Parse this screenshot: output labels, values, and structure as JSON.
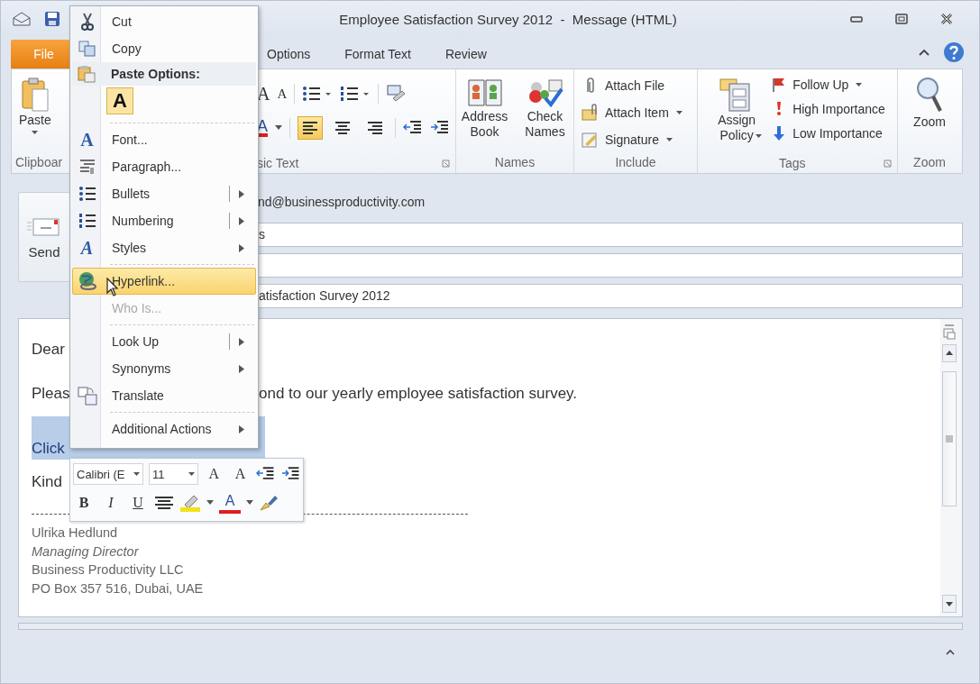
{
  "window": {
    "title": "Employee Satisfaction Survey 2012  -  Message (HTML)"
  },
  "tabs": [
    {
      "label": "File",
      "kind": "file"
    },
    {
      "label": "Options",
      "kind": "tab"
    },
    {
      "label": "Format Text",
      "kind": "tab"
    },
    {
      "label": "Review",
      "kind": "tab"
    }
  ],
  "clipboard": {
    "label": "Clipboar",
    "paste": "Paste"
  },
  "basic_text": {
    "label": "sic Text",
    "grow_font": "A",
    "shrink_font": "A",
    "font_color": "A",
    "align": [
      {
        "selected": true
      },
      {
        "selected": false
      },
      {
        "selected": false
      }
    ]
  },
  "names": {
    "label": "Names",
    "buttons": [
      "Address Book",
      "Check Names"
    ]
  },
  "include": {
    "label": "Include",
    "buttons": [
      {
        "label": "Attach File",
        "dropdown": false
      },
      {
        "label": "Attach Item",
        "dropdown": true
      },
      {
        "label": "Signature",
        "dropdown": true
      }
    ]
  },
  "tags": {
    "label": "Tags",
    "assign_policy": "Assign Policy",
    "buttons": [
      {
        "label": "Follow Up",
        "dropdown": true
      },
      {
        "label": "High Importance",
        "dropdown": false
      },
      {
        "label": "Low Importance",
        "dropdown": false
      }
    ]
  },
  "zoom": {
    "label": "Zoom",
    "button": "Zoom"
  },
  "message": {
    "send": "Send",
    "from": "nd@businessproductivity.com",
    "to": "s",
    "subject": "atisfaction Survey 2012"
  },
  "body": {
    "greeting": "Dear",
    "line_start": "Pleas",
    "line_end": "ond to our yearly employee satisfaction survey.",
    "link": "Click",
    "closing": "Kind",
    "signature": [
      {
        "text": "Ulrika Hedlund",
        "italic": false
      },
      {
        "text": "Managing Director",
        "italic": true
      },
      {
        "text": "Business Productivity LLC",
        "italic": false
      },
      {
        "text": "PO Box 357 516, Dubai, UAE",
        "italic": false
      }
    ]
  },
  "context_menu": {
    "items": [
      {
        "kind": "item",
        "label": "Cut",
        "selected": false,
        "disabled": false
      },
      {
        "kind": "item",
        "label": "Copy",
        "selected": false,
        "disabled": false
      },
      {
        "kind": "header",
        "label": "Paste Options:"
      },
      {
        "kind": "paste",
        "label": "A"
      },
      {
        "kind": "separator"
      },
      {
        "kind": "item",
        "label": "Font...",
        "glyph": "A",
        "selected": false,
        "disabled": false
      },
      {
        "kind": "item",
        "label": "Paragraph...",
        "selected": false,
        "disabled": false
      },
      {
        "kind": "item",
        "label": "Bullets",
        "submenu": true,
        "split": true,
        "selected": false,
        "disabled": false
      },
      {
        "kind": "item",
        "label": "Numbering",
        "submenu": true,
        "split": true,
        "selected": false,
        "disabled": false
      },
      {
        "kind": "item",
        "label": "Styles",
        "glyph": "A",
        "submenu": true,
        "selected": false,
        "disabled": false
      },
      {
        "kind": "separator"
      },
      {
        "kind": "item",
        "label": "Hyperlink...",
        "selected": true,
        "disabled": false
      },
      {
        "kind": "item",
        "label": "Who Is...",
        "selected": false,
        "disabled": true
      },
      {
        "kind": "separator"
      },
      {
        "kind": "item",
        "label": "Look Up",
        "submenu": true,
        "split": true,
        "selected": false,
        "disabled": false
      },
      {
        "kind": "item",
        "label": "Synonyms",
        "submenu": true,
        "selected": false,
        "disabled": false
      },
      {
        "kind": "item",
        "label": "Translate",
        "selected": false,
        "disabled": false
      },
      {
        "kind": "separator"
      },
      {
        "kind": "item",
        "label": "Additional Actions",
        "submenu": true,
        "selected": false,
        "disabled": false
      }
    ]
  },
  "mini_toolbar": {
    "font": "Calibri (E",
    "size": "11",
    "grow_font": "A",
    "shrink_font": "A",
    "bold": "B",
    "italic": "I",
    "underline": "U",
    "font_color": "A"
  }
}
